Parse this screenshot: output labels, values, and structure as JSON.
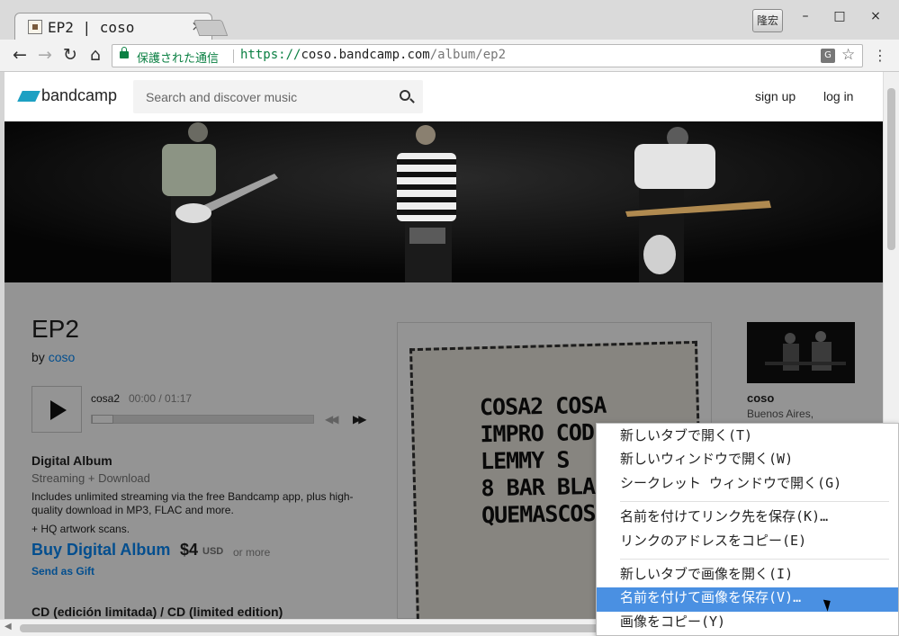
{
  "browser": {
    "tab_title": "EP2 | coso",
    "tab_close": "×",
    "ime_label": "隆宏",
    "window_controls": {
      "minimize": "–",
      "maximize": "□",
      "close": "×"
    },
    "nav": {
      "back": "←",
      "forward": "→",
      "reload": "↻",
      "home": "⌂"
    },
    "security_text": "保護された通信",
    "url_scheme": "https://",
    "url_host": "coso.bandcamp.com",
    "url_path": "/album/ep2",
    "translate_icon": "G",
    "star_icon": "☆",
    "menu_icon": "⋮"
  },
  "header": {
    "logo_text": "bandcamp",
    "search_placeholder": "Search and discover music",
    "sign_up": "sign up",
    "log_in": "log in"
  },
  "album": {
    "title": "EP2",
    "by": "by",
    "artist": "coso"
  },
  "player": {
    "track": "cosa2",
    "time": "00:00 / 01:17",
    "prev_icon": "◀◀",
    "next_icon": "▶▶"
  },
  "purchase": {
    "heading": "Digital Album",
    "sub": "Streaming + Download",
    "desc": "Includes unlimited streaming via the free Bandcamp app, plus high-quality download in MP3, FLAC and more.",
    "extra": "+ HQ artwork scans.",
    "buy_label": "Buy Digital Album",
    "price": "$4",
    "currency": "USD",
    "or_more": "or more",
    "gift": "Send as Gift",
    "cd_heading": "CD (edición limitada) / CD (limited edition)"
  },
  "artwork": {
    "lines": "COSA2 COSA\nIMPRO COD\nLEMMY S\n8 BAR BLA\nQUEMASCOS"
  },
  "artist_panel": {
    "name": "coso",
    "location": "Buenos Aires,"
  },
  "context_menu": {
    "items": [
      "新しいタブで開く(T)",
      "新しいウィンドウで開く(W)",
      "シークレット ウィンドウで開く(G)",
      "名前を付けてリンク先を保存(K)…",
      "リンクのアドレスをコピー(E)",
      "新しいタブで画像を開く(I)",
      "名前を付けて画像を保存(V)…",
      "画像をコピー(Y)"
    ],
    "highlighted_index": 6
  },
  "colors": {
    "bandcamp_blue": "#1da0c3",
    "link_blue": "#0687f5",
    "secure_green": "#0b8043",
    "menu_highlight": "#4a90e2"
  }
}
